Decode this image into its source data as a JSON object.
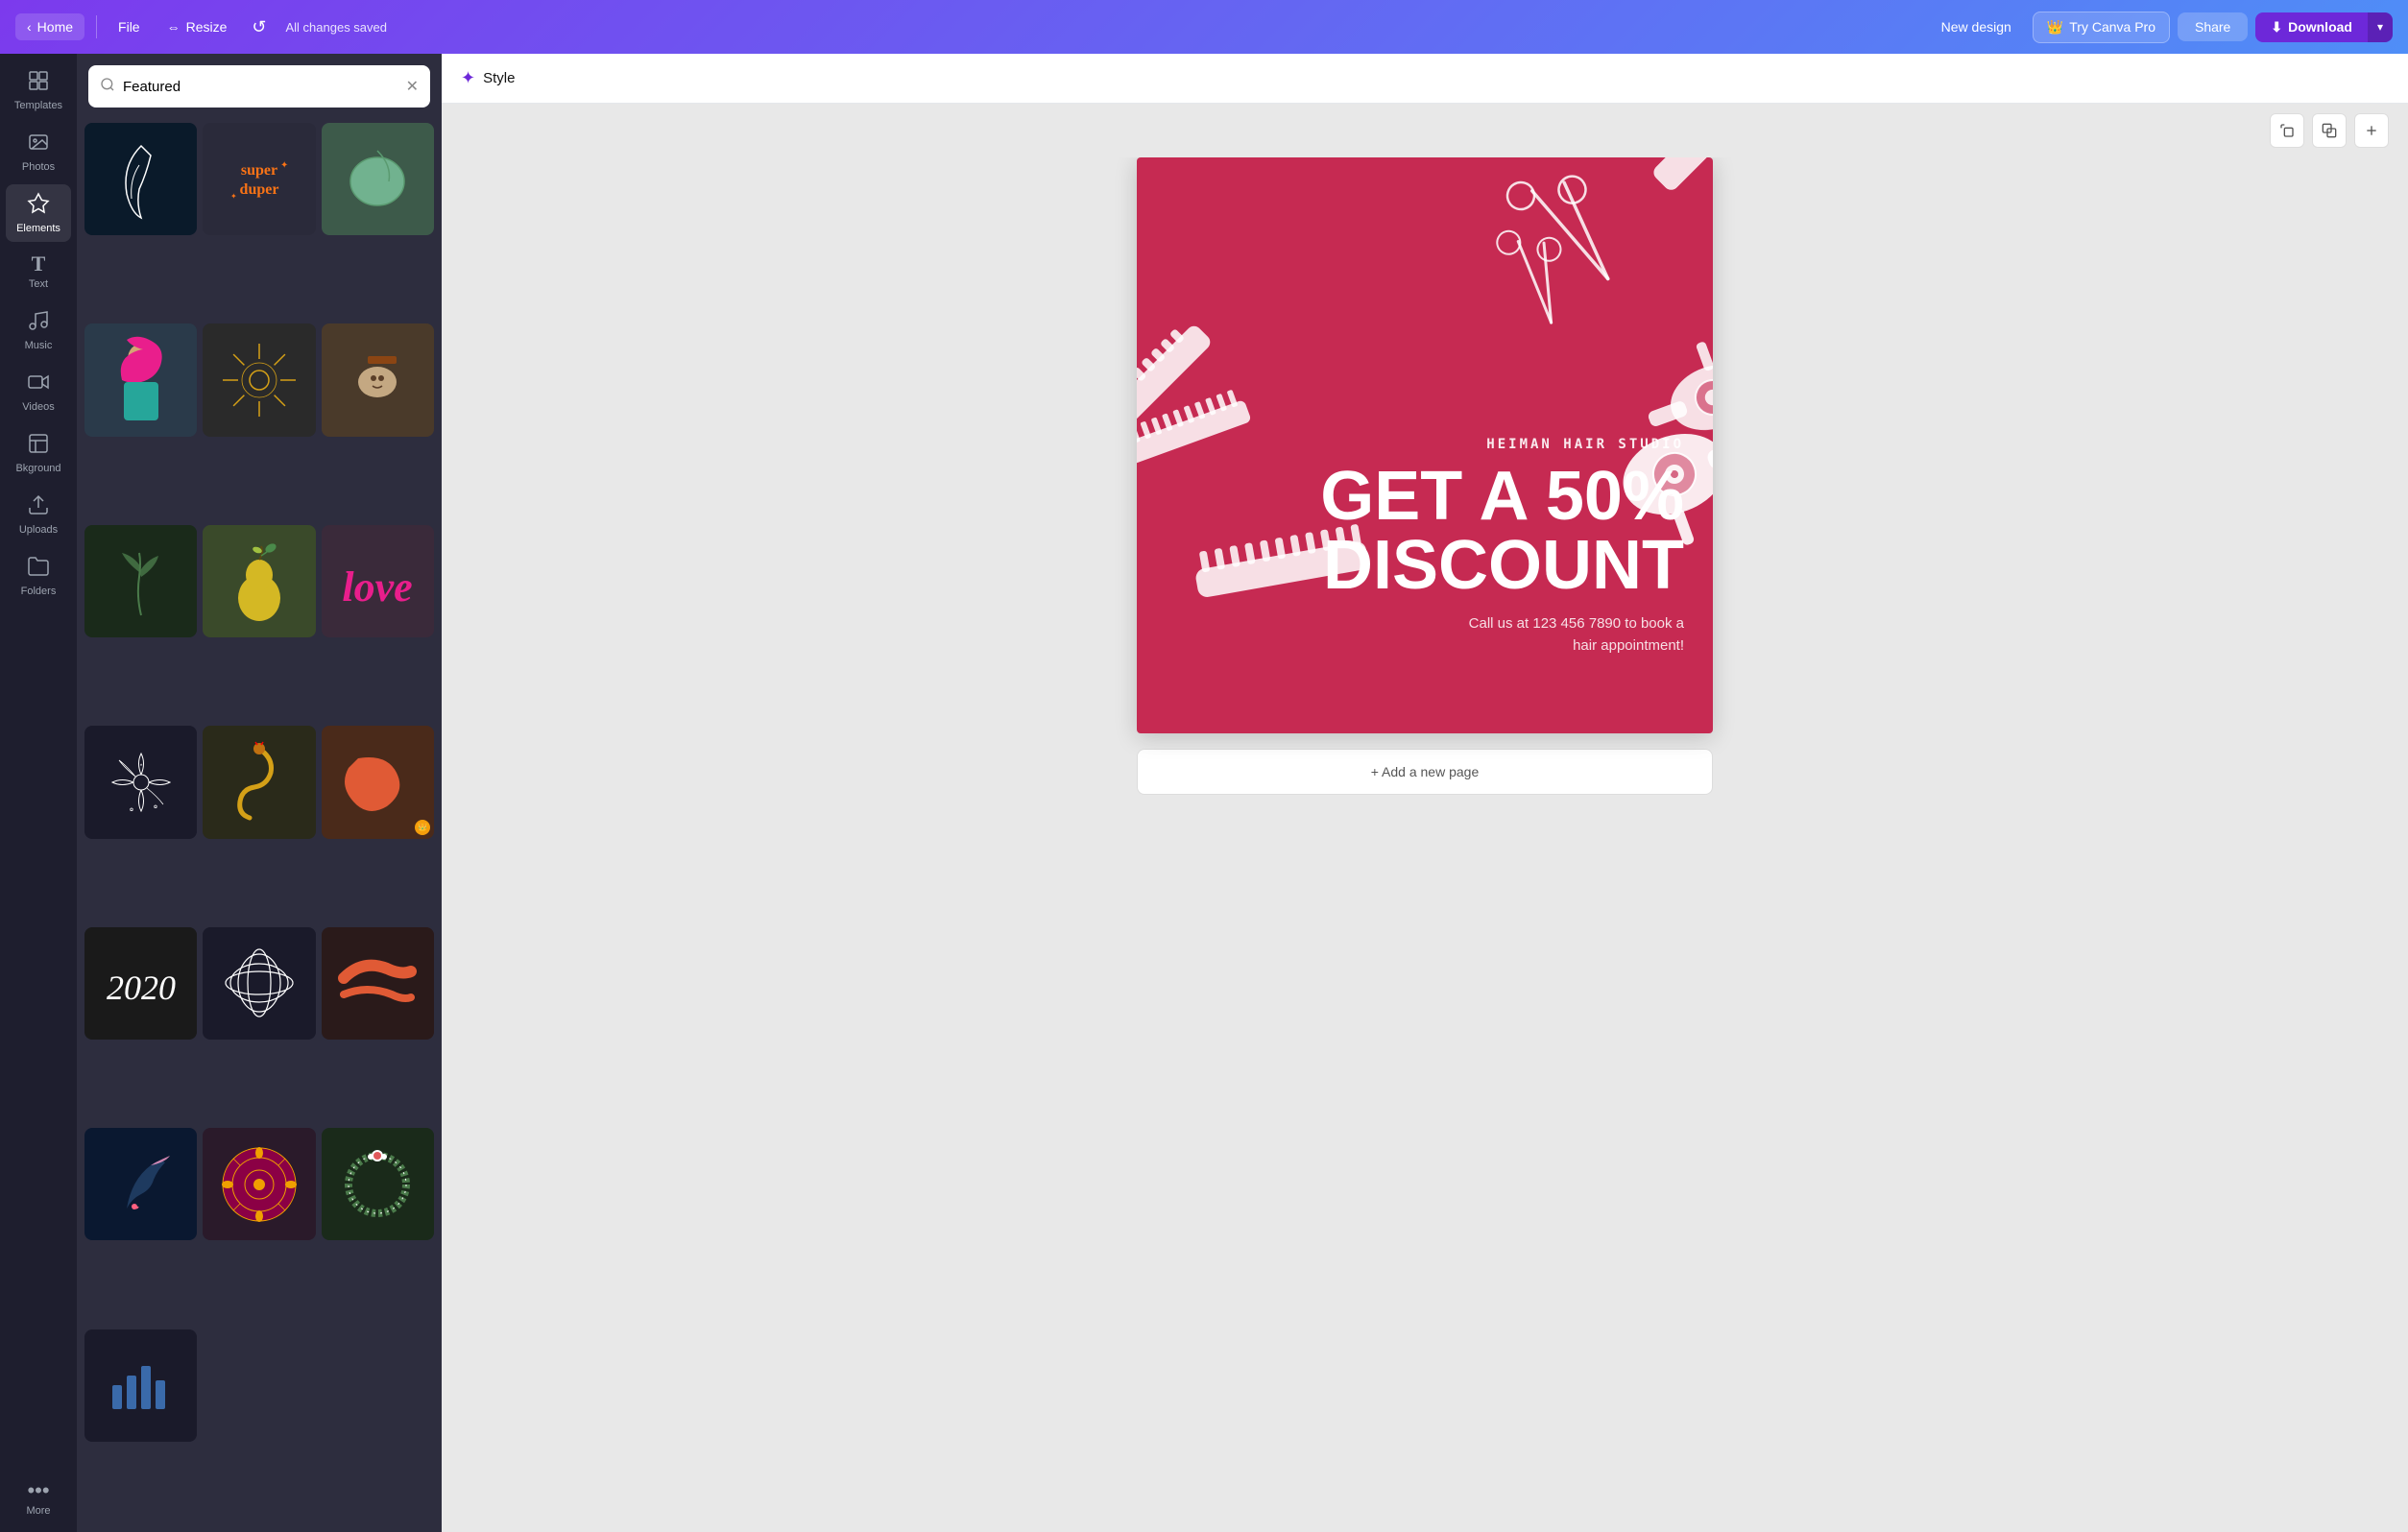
{
  "nav": {
    "home_label": "Home",
    "file_label": "File",
    "resize_label": "Resize",
    "saved_status": "All changes saved",
    "new_design_label": "New design",
    "try_pro_label": "Try Canva Pro",
    "share_label": "Share",
    "download_label": "Download"
  },
  "sidebar": {
    "items": [
      {
        "id": "templates",
        "icon": "⊞",
        "label": "Templates"
      },
      {
        "id": "photos",
        "icon": "🖼",
        "label": "Photos"
      },
      {
        "id": "elements",
        "icon": "✦",
        "label": "Elements"
      },
      {
        "id": "text",
        "icon": "T",
        "label": "Text"
      },
      {
        "id": "music",
        "icon": "♪",
        "label": "Music"
      },
      {
        "id": "videos",
        "icon": "▶",
        "label": "Videos"
      },
      {
        "id": "background",
        "icon": "▧",
        "label": "Bkground"
      },
      {
        "id": "uploads",
        "icon": "↑",
        "label": "Uploads"
      },
      {
        "id": "folders",
        "icon": "📁",
        "label": "Folders"
      },
      {
        "id": "more",
        "icon": "•••",
        "label": "More"
      }
    ]
  },
  "panel": {
    "search_placeholder": "Featured",
    "search_value": "Featured"
  },
  "style_bar": {
    "icon": "✦",
    "label": "Style"
  },
  "canvas": {
    "add_page_label": "+ Add a new page"
  },
  "design": {
    "studio_name": "HEIMAN HAIR STUDIO",
    "headline_line1": "GET A 50%",
    "headline_line2": "DISCOUNT",
    "subtext": "Call us at 123 456 7890 to book a\nhair appointment!",
    "bg_color": "#c62a52"
  },
  "toolbar": {
    "duplicate_icon": "⧉",
    "copy_icon": "⎘",
    "add_icon": "+"
  }
}
